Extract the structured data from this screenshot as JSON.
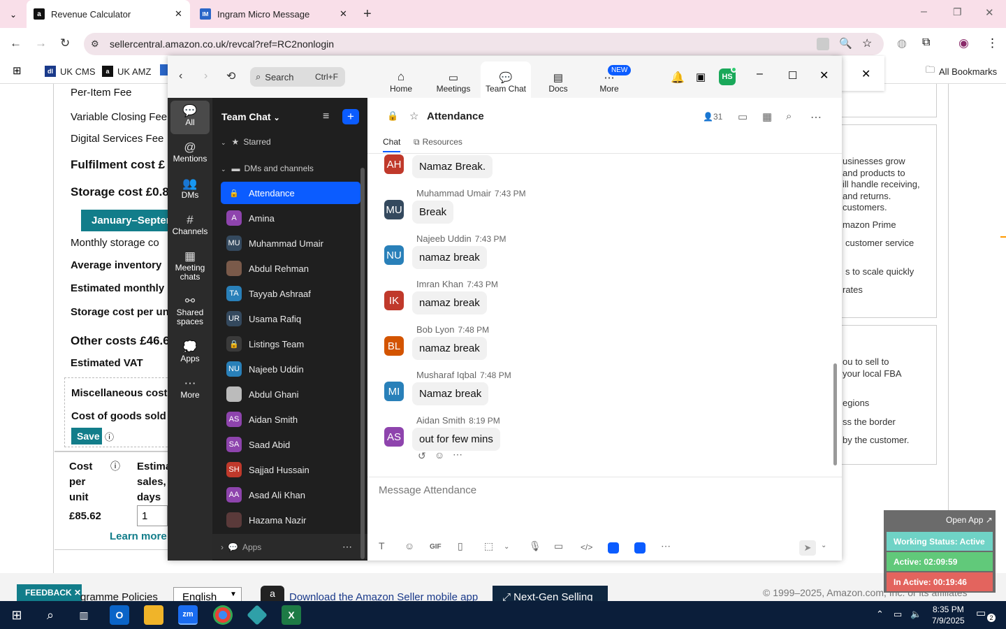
{
  "browser": {
    "tabs": [
      {
        "title": "Revenue Calculator",
        "favicon": "a"
      },
      {
        "title": "Ingram Micro Message",
        "favicon": "IM"
      }
    ],
    "url": "sellercentral.amazon.co.uk/revcal?ref=RC2nonlogin",
    "bookmarks": [
      "UK CMS",
      "UK AMZ"
    ],
    "all_bookmarks": "All Bookmarks"
  },
  "amazon": {
    "left": [
      "Per-Item Fee",
      "Variable Closing Fee",
      "Digital Services Fee",
      "Fulfilment cost  £",
      "Storage cost  £0.8",
      "January–Septer",
      "Monthly storage co",
      "Average inventory",
      "Estimated monthly",
      "Storage cost per un",
      "Other costs  £46.6",
      "Estimated VAT",
      "Miscellaneous cost",
      "Cost of goods sold",
      "Save"
    ],
    "cpu": {
      "l1": "Cost",
      "l2": "per",
      "l3": "unit",
      "value": "£85.62",
      "e1": "Estima",
      "e2": "sales,",
      "e3": "days",
      "input": "1",
      "learn": "Learn more"
    },
    "right1": [
      "usinesses grow",
      "and products to",
      "ill handle receiving,",
      "and returns.",
      "customers.",
      "mazon Prime",
      "customer service",
      "s to scale quickly",
      "rates"
    ],
    "right2": [
      "ou to sell to",
      "your local FBA",
      "egions",
      "ss the border",
      "by the customer."
    ],
    "footer": {
      "feedback": "FEEDBACK",
      "policies": "gramme Policies",
      "lang": "English",
      "app": "Download the Amazon Seller mobile app",
      "nextgen": "Next-Gen Selling",
      "copy": "© 1999–2025, Amazon.com, Inc. or its affiliates"
    }
  },
  "zoom": {
    "search": "Search",
    "shortcut": "Ctrl+F",
    "avatar": "HS",
    "nav": [
      {
        "label": "Home"
      },
      {
        "label": "Meetings"
      },
      {
        "label": "Team Chat"
      },
      {
        "label": "Docs"
      },
      {
        "label": "More",
        "badge": "NEW"
      }
    ],
    "rail": [
      "All",
      "Mentions",
      "DMs",
      "Channels",
      "Meeting chats",
      "Shared spaces",
      "Apps",
      "More"
    ],
    "list_title": "Team Chat",
    "starred": "Starred",
    "dms_header": "DMs and channels",
    "apps": "Apps",
    "channel": {
      "name": "Attendance",
      "members": "31",
      "tab_chat": "Chat",
      "tab_resources": "Resources",
      "placeholder": "Message Attendance"
    },
    "contacts": [
      {
        "name": "Attendance",
        "init": "",
        "color": "#0b5cff"
      },
      {
        "name": "Amina",
        "init": "A",
        "color": "#8e44ad"
      },
      {
        "name": "Muhammad Umair",
        "init": "MU",
        "color": "#34495e"
      },
      {
        "name": "Abdul Rehman",
        "init": "",
        "color": "#7a5a4a"
      },
      {
        "name": "Tayyab Ashraaf",
        "init": "TA",
        "color": "#2980b9"
      },
      {
        "name": "Usama Rafiq",
        "init": "UR",
        "color": "#34495e"
      },
      {
        "name": "Listings Team",
        "init": "",
        "color": "#3a3a3a"
      },
      {
        "name": "Najeeb Uddin",
        "init": "NU",
        "color": "#2980b9"
      },
      {
        "name": "Abdul Ghani",
        "init": "",
        "color": "#bbb"
      },
      {
        "name": "Aidan Smith",
        "init": "AS",
        "color": "#8e44ad"
      },
      {
        "name": "Saad Abid",
        "init": "SA",
        "color": "#8e44ad"
      },
      {
        "name": "Sajjad Hussain",
        "init": "SH",
        "color": "#c0392b"
      },
      {
        "name": "Asad Ali Khan",
        "init": "AA",
        "color": "#8e44ad"
      },
      {
        "name": "Hazama Nazir",
        "init": "",
        "color": "#5a3a3a"
      }
    ],
    "messages": [
      {
        "init": "AH",
        "color": "#c0392b",
        "sender": "",
        "time": "",
        "text": "Namaz Break."
      },
      {
        "init": "MU",
        "color": "#34495e",
        "sender": "Muhammad Umair",
        "time": "7:43 PM",
        "text": "Break"
      },
      {
        "init": "NU",
        "color": "#2980b9",
        "sender": "Najeeb Uddin",
        "time": "7:43 PM",
        "text": "namaz break"
      },
      {
        "init": "IK",
        "color": "#c0392b",
        "sender": "Imran Khan",
        "time": "7:43 PM",
        "text": "namaz break"
      },
      {
        "init": "BL",
        "color": "#d35400",
        "sender": "Bob Lyon",
        "time": "7:48 PM",
        "text": "namaz break"
      },
      {
        "init": "MI",
        "color": "#2980b9",
        "sender": "Musharaf Iqbal",
        "time": "7:48 PM",
        "text": "Namaz break"
      },
      {
        "init": "AS",
        "color": "#8e44ad",
        "sender": "Aidan Smith",
        "time": "8:19 PM",
        "text": "out for few mins"
      }
    ]
  },
  "widget": {
    "open": "Open App ↗",
    "status": "Working Status: Active",
    "active": "Active: 02:09:59",
    "inactive": "In Active: 00:19:46"
  },
  "taskbar": {
    "time": "8:35 PM",
    "date": "7/9/2025",
    "notif": "2"
  }
}
